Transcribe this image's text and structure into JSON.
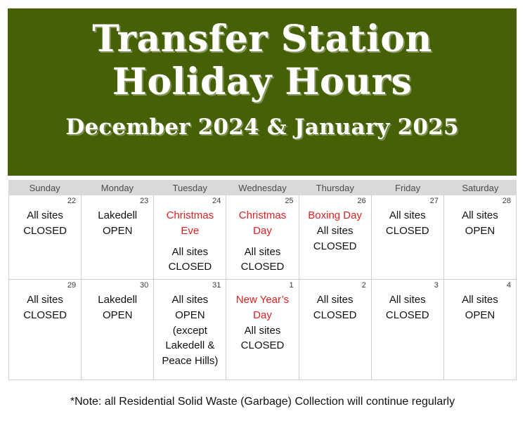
{
  "banner": {
    "title_line1": "Transfer Station",
    "title_line2": "Holiday Hours",
    "subtitle": "December 2024 & January 2025",
    "background_color": "#466005",
    "text_color": "#ffffff"
  },
  "calendar": {
    "weekday_headers": [
      "Sunday",
      "Monday",
      "Tuesday",
      "Wednesday",
      "Thursday",
      "Friday",
      "Saturday"
    ],
    "header_background_color": "#d9d9d9",
    "holiday_text_color": "#e02020",
    "weeks": [
      {
        "days": [
          {
            "number": "22",
            "holiday": "",
            "status_line1": "All sites",
            "status_line2": "CLOSED",
            "status_line3": "",
            "status_line4": "",
            "spacer": false
          },
          {
            "number": "23",
            "holiday": "",
            "status_line1": "Lakedell",
            "status_line2": "OPEN",
            "status_line3": "",
            "status_line4": "",
            "spacer": false
          },
          {
            "number": "24",
            "holiday": "Christmas",
            "holiday_line2": "Eve",
            "status_line1": "All sites",
            "status_line2": "CLOSED",
            "status_line3": "",
            "status_line4": "",
            "spacer": true
          },
          {
            "number": "25",
            "holiday": "Christmas",
            "holiday_line2": "Day",
            "status_line1": "All sites",
            "status_line2": "CLOSED",
            "status_line3": "",
            "status_line4": "",
            "spacer": true
          },
          {
            "number": "26",
            "holiday": "Boxing Day",
            "holiday_line2": "",
            "status_line1": "All sites",
            "status_line2": "CLOSED",
            "status_line3": "",
            "status_line4": "",
            "spacer": false
          },
          {
            "number": "27",
            "holiday": "",
            "status_line1": "All sites",
            "status_line2": "CLOSED",
            "status_line3": "",
            "status_line4": "",
            "spacer": false
          },
          {
            "number": "28",
            "holiday": "",
            "status_line1": "All sites",
            "status_line2": "OPEN",
            "status_line3": "",
            "status_line4": "",
            "spacer": false
          }
        ]
      },
      {
        "days": [
          {
            "number": "29",
            "holiday": "",
            "status_line1": "All sites",
            "status_line2": "CLOSED",
            "status_line3": "",
            "status_line4": "",
            "spacer": false
          },
          {
            "number": "30",
            "holiday": "",
            "status_line1": "Lakedell",
            "status_line2": "OPEN",
            "status_line3": "",
            "status_line4": "",
            "spacer": false
          },
          {
            "number": "31",
            "holiday": "",
            "status_line1": "All sites",
            "status_line2": "OPEN",
            "status_line3": "(except",
            "status_line4": "Lakedell &",
            "status_line5": "Peace Hills)",
            "spacer": false
          },
          {
            "number": "1",
            "holiday": "New Year’s",
            "holiday_line2": "Day",
            "status_line1": "All sites",
            "status_line2": "CLOSED",
            "status_line3": "",
            "status_line4": "",
            "spacer": false
          },
          {
            "number": "2",
            "holiday": "",
            "status_line1": "All sites",
            "status_line2": "CLOSED",
            "status_line3": "",
            "status_line4": "",
            "spacer": false
          },
          {
            "number": "3",
            "holiday": "",
            "status_line1": "All sites",
            "status_line2": "CLOSED",
            "status_line3": "",
            "status_line4": "",
            "spacer": false
          },
          {
            "number": "4",
            "holiday": "",
            "status_line1": "All sites",
            "status_line2": "OPEN",
            "status_line3": "",
            "status_line4": "",
            "spacer": false
          }
        ]
      }
    ]
  },
  "footnote": {
    "text": "*Note: all Residential Solid Waste (Garbage) Collection will continue regularly"
  }
}
